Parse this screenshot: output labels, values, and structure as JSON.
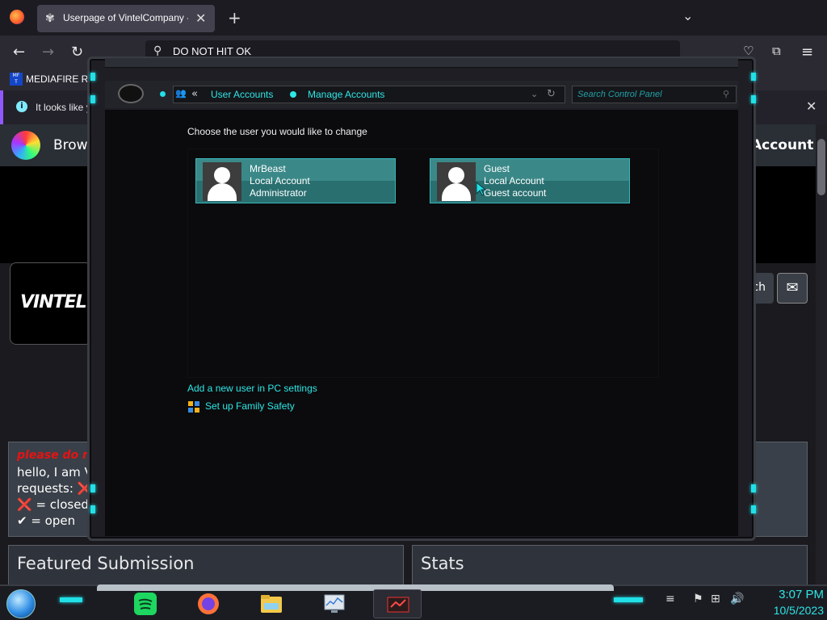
{
  "browser": {
    "tab_title": "Userpage of VintelCompany -- F",
    "url_text": "DO NOT HIT OK",
    "bookmark": "MEDIAFIRE RO",
    "notice": "It looks like y"
  },
  "website": {
    "browse": "Brows",
    "account": "Account",
    "avatar_logo": "VINTEL",
    "watch": "tch",
    "about_warning": "please do no",
    "about_lines": [
      "hello, I am Vi",
      "requests: ❌",
      "❌ = closed",
      "✔ = open"
    ],
    "featured_title": "Featured Submission",
    "stats_title": "Stats"
  },
  "control_panel": {
    "breadcrumb": [
      "User Accounts",
      "Manage Accounts"
    ],
    "search_placeholder": "Search Control Panel",
    "choose_label": "Choose the user you would like to change",
    "users": [
      {
        "name": "MrBeast",
        "type": "Local Account",
        "role": "Administrator"
      },
      {
        "name": "Guest",
        "type": "Local Account",
        "role": "Guest account"
      }
    ],
    "link_add_user": "Add a new user in PC settings",
    "link_family": "Set up Family Safety"
  },
  "taskbar": {
    "time": "3:07 PM",
    "date": "10/5/2023"
  },
  "colors": {
    "accent_cyan": "#2ee6e6",
    "tile_teal": "#2a6f70"
  }
}
